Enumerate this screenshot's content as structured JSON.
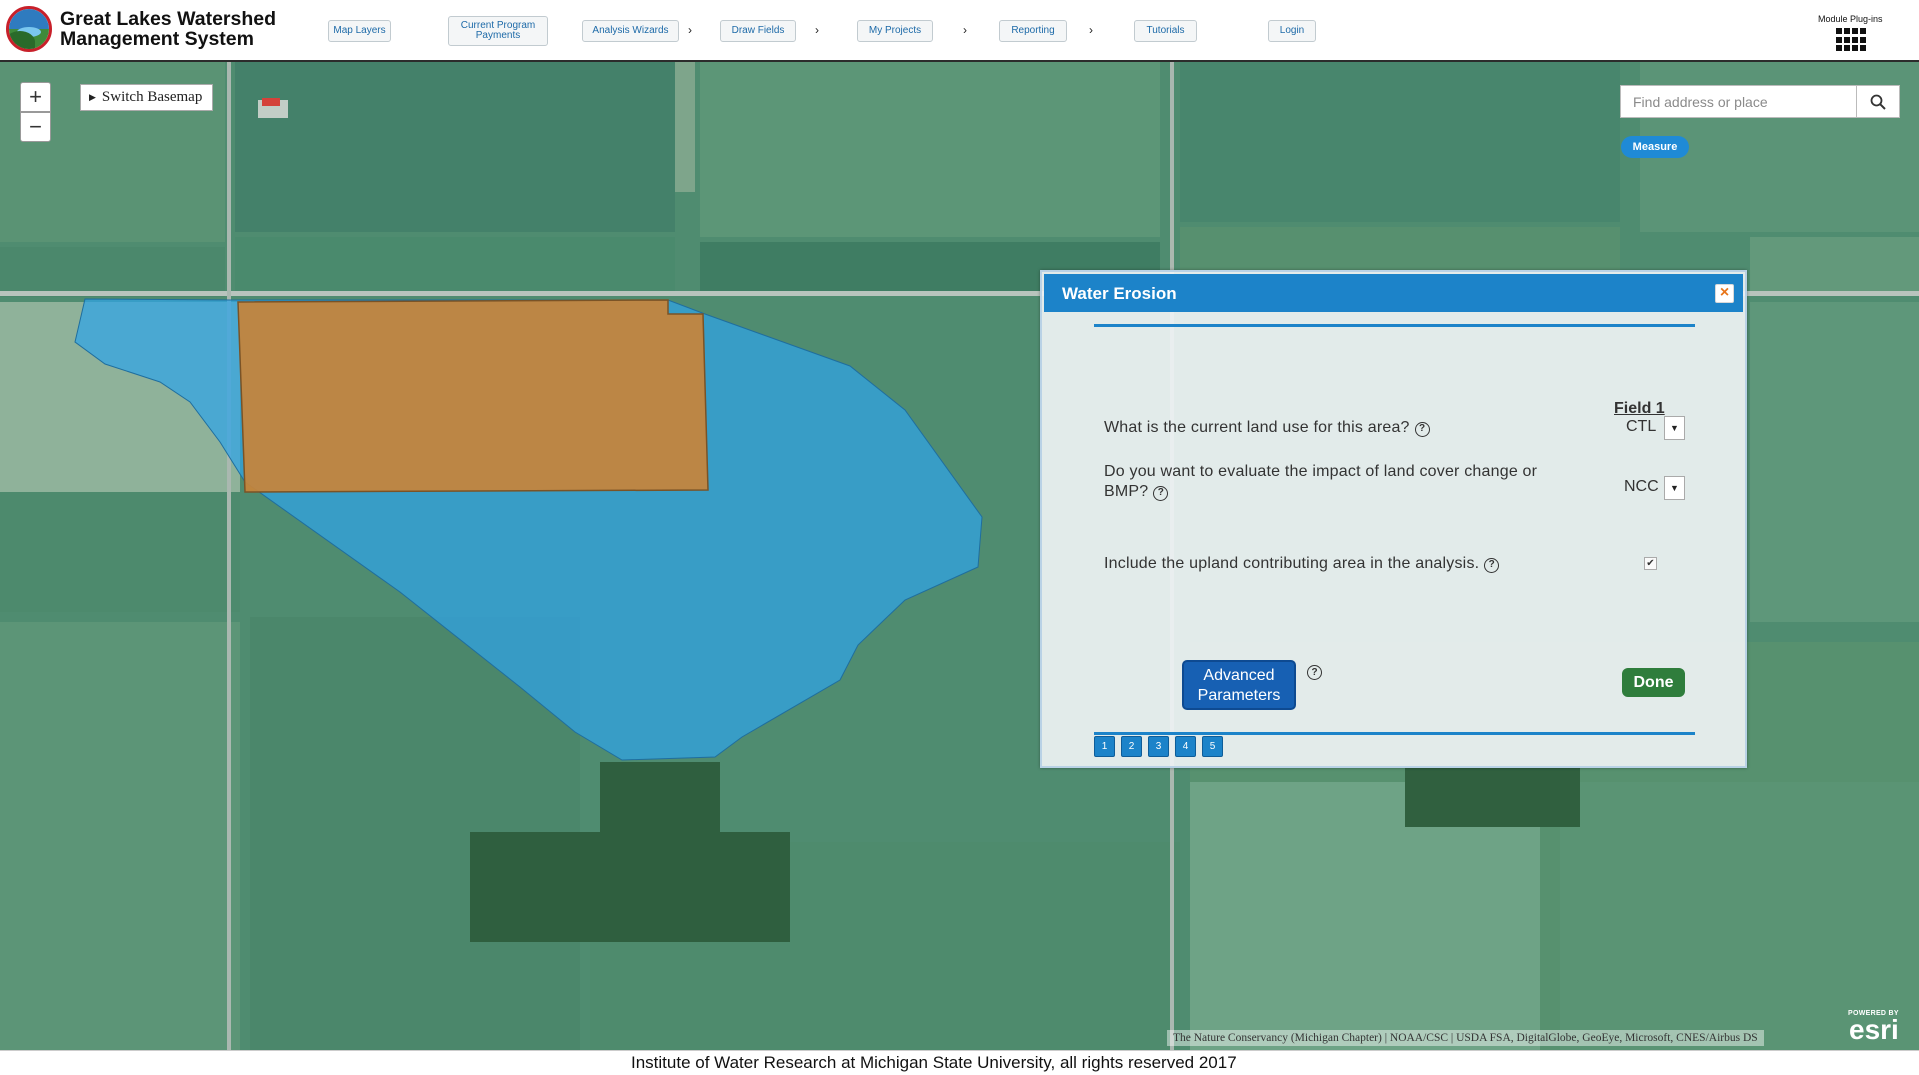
{
  "header": {
    "title_line1": "Great Lakes Watershed",
    "title_line2": "Management System",
    "nav": [
      {
        "label": "Map Layers"
      },
      {
        "label": "Current Program Payments"
      },
      {
        "label": "Analysis Wizards"
      },
      {
        "label": "Draw Fields"
      },
      {
        "label": "My Projects"
      },
      {
        "label": "Reporting"
      },
      {
        "label": "Tutorials"
      },
      {
        "label": "Login"
      }
    ],
    "nav_arrow": "›",
    "module_label": "Module Plug-ins"
  },
  "map": {
    "zoom_in": "+",
    "zoom_out": "−",
    "basemap_label": "Switch Basemap",
    "search_placeholder": "Find address or place",
    "measure_label": "Measure",
    "attribution": "The Nature Conservancy (Michigan Chapter) | NOAA/CSC | USDA FSA, DigitalGlobe, GeoEye, Microsoft, CNES/Airbus DS",
    "esri_powered": "POWERED BY",
    "esri_logo": "esri",
    "colors": {
      "field_fill": "#c8843a",
      "watershed_fill": "#2fa3e8"
    }
  },
  "dialog": {
    "title": "Water Erosion",
    "close": "×",
    "field_heading": "Field 1",
    "questions": [
      {
        "text": "What is the current land use for this area?",
        "value": "CTL"
      },
      {
        "text_line1": "Do you want to evaluate the impact of land cover change or",
        "text_line2": "BMP?",
        "value": "NCC"
      },
      {
        "text": "Include the upland contributing area in the analysis.",
        "checked": "✔"
      }
    ],
    "help_glyph": "?",
    "advanced_line1": "Advanced",
    "advanced_line2": "Parameters",
    "done_label": "Done",
    "steps": [
      "1",
      "2",
      "3",
      "4",
      "5"
    ]
  },
  "footer": {
    "text": "Institute of Water Research at Michigan State University, all rights reserved 2017"
  }
}
